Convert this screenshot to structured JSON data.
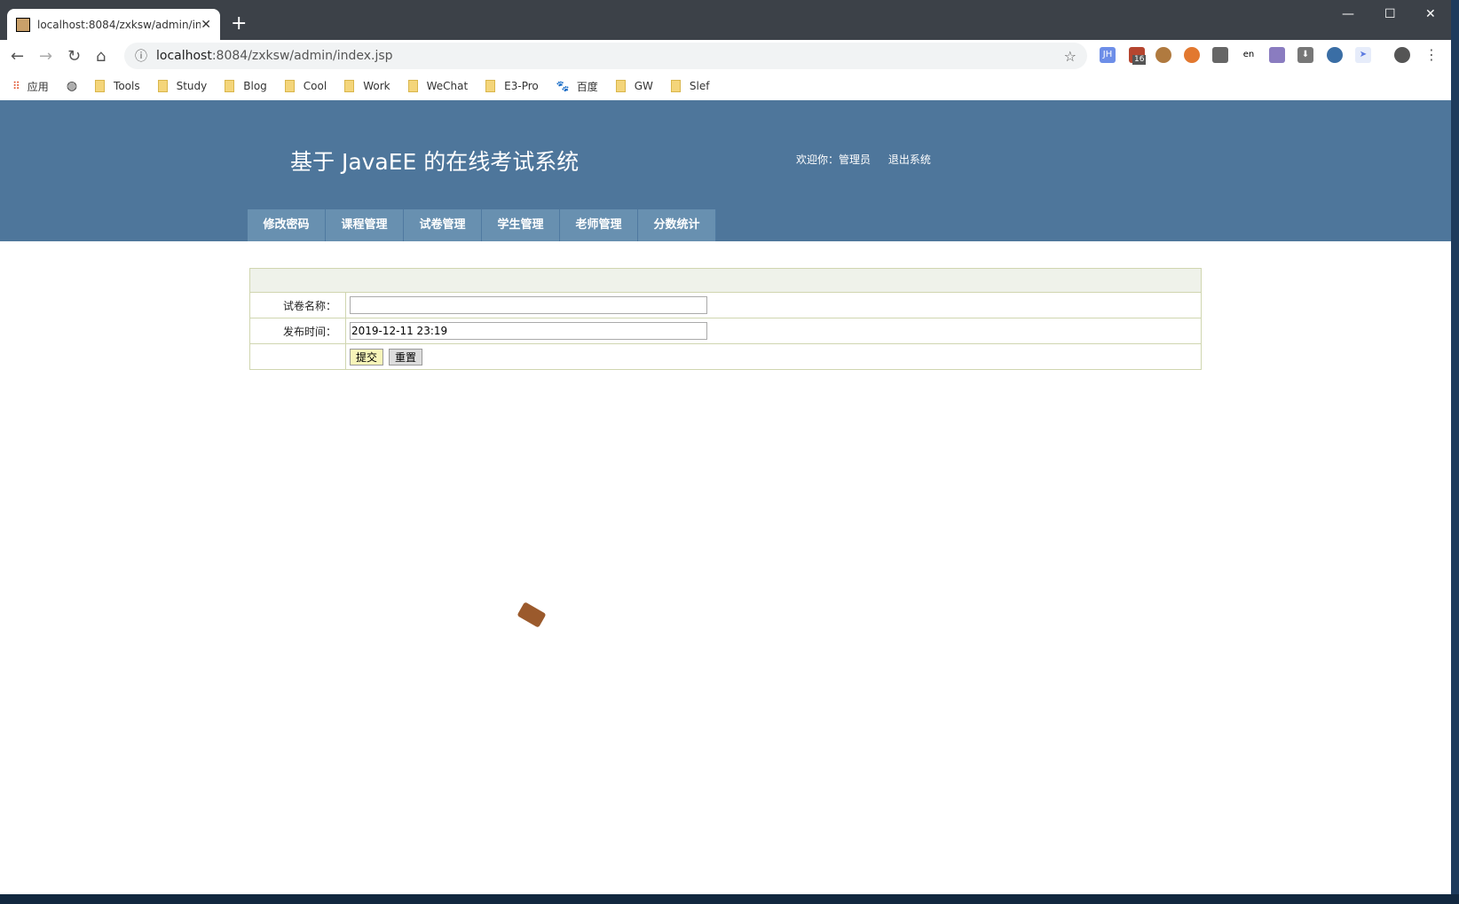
{
  "browser": {
    "tab_title": "localhost:8084/zxksw/admin/index.jsp",
    "url_host": "localhost",
    "url_rest": ":8084/zxksw/admin/index.jsp",
    "ext_badge": "16",
    "ext_jh": "JH",
    "bookmarks": [
      {
        "label": "应用",
        "icon": "apps-icon"
      },
      {
        "label": "",
        "icon": "globe-icon"
      },
      {
        "label": "Tools"
      },
      {
        "label": "Study"
      },
      {
        "label": "Blog"
      },
      {
        "label": "Cool"
      },
      {
        "label": "Work"
      },
      {
        "label": "WeChat"
      },
      {
        "label": "E3-Pro"
      },
      {
        "label": "百度",
        "icon": "baidu-icon"
      },
      {
        "label": "GW"
      },
      {
        "label": "Slef"
      }
    ]
  },
  "header": {
    "title": "基于 JavaEE 的在线考试系统",
    "welcome": "欢迎你：管理员",
    "logout": "退出系统",
    "bg": "#4e769b"
  },
  "menu": [
    "修改密码",
    "课程管理",
    "试卷管理",
    "学生管理",
    "老师管理",
    "分数统计"
  ],
  "form": {
    "name_label": "试卷名称：",
    "name_value": "",
    "time_label": "发布时间：",
    "time_value": "2019-12-11 23:19",
    "submit": "提交",
    "reset": "重置"
  }
}
